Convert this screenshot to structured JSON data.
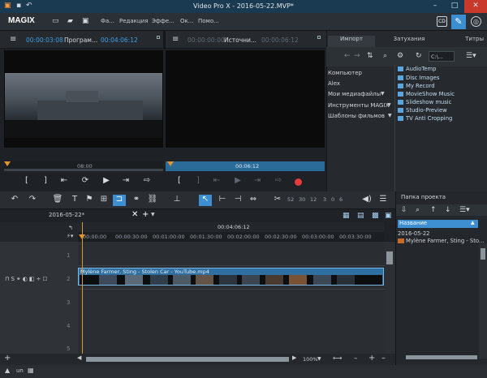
{
  "window": {
    "title": "Video Pro X - 2016-05-22.MVP*"
  },
  "brand": "MAGIX",
  "menu": [
    "Фа...",
    "Редакция",
    "Эффе...",
    "Ок...",
    "Помо..."
  ],
  "monitor_a": {
    "timecode": "00:00:03:08",
    "label": "Програм...",
    "duration": "00:04:06:12",
    "ruler_time": "08:00"
  },
  "monitor_b": {
    "timecode": "00:00:00:00",
    "label": "Источни...",
    "duration": "00:00:06:12",
    "ruler_time": "00:06:12"
  },
  "right_tabs": [
    "Импорт",
    "Затухания",
    "Титры"
  ],
  "dropdown_value": "С:\\...",
  "tree": [
    "Компьютер",
    "Alex",
    "Мои медиафайлы",
    "Инструменты MAGIX",
    "Шаблоны фильмов"
  ],
  "folders": [
    "AudioTemp",
    "Disc Images",
    "My Record",
    "MovieShow Music",
    "Slideshow music",
    "Studio-Preview",
    "TV Anti Cropping"
  ],
  "timeline": {
    "tab": "2016-05-22*",
    "playhead_time": "00:04:06:12",
    "ticks": [
      "00:00:00",
      "00:00:30:00",
      "00:01:00:00",
      "00:01:30:00",
      "00:02:00:00",
      "00:02:30:00",
      "00:03:00:00",
      "00:03:30:00"
    ],
    "track_numbers": [
      "1",
      "2",
      "3",
      "4",
      "5"
    ],
    "clip_name": "Mylène Farmer, Sting - Stolen Car - YouTube.mp4",
    "zoom": "100%",
    "scale_marks": [
      "52",
      "30",
      "12",
      "3",
      "0",
      "6"
    ]
  },
  "project": {
    "title": "Папка проекта",
    "column": "Название",
    "folder": "2016-05-22",
    "item": "Mylène Farmer, Sting - Sto..."
  },
  "statusbar": {
    "left": "un"
  }
}
